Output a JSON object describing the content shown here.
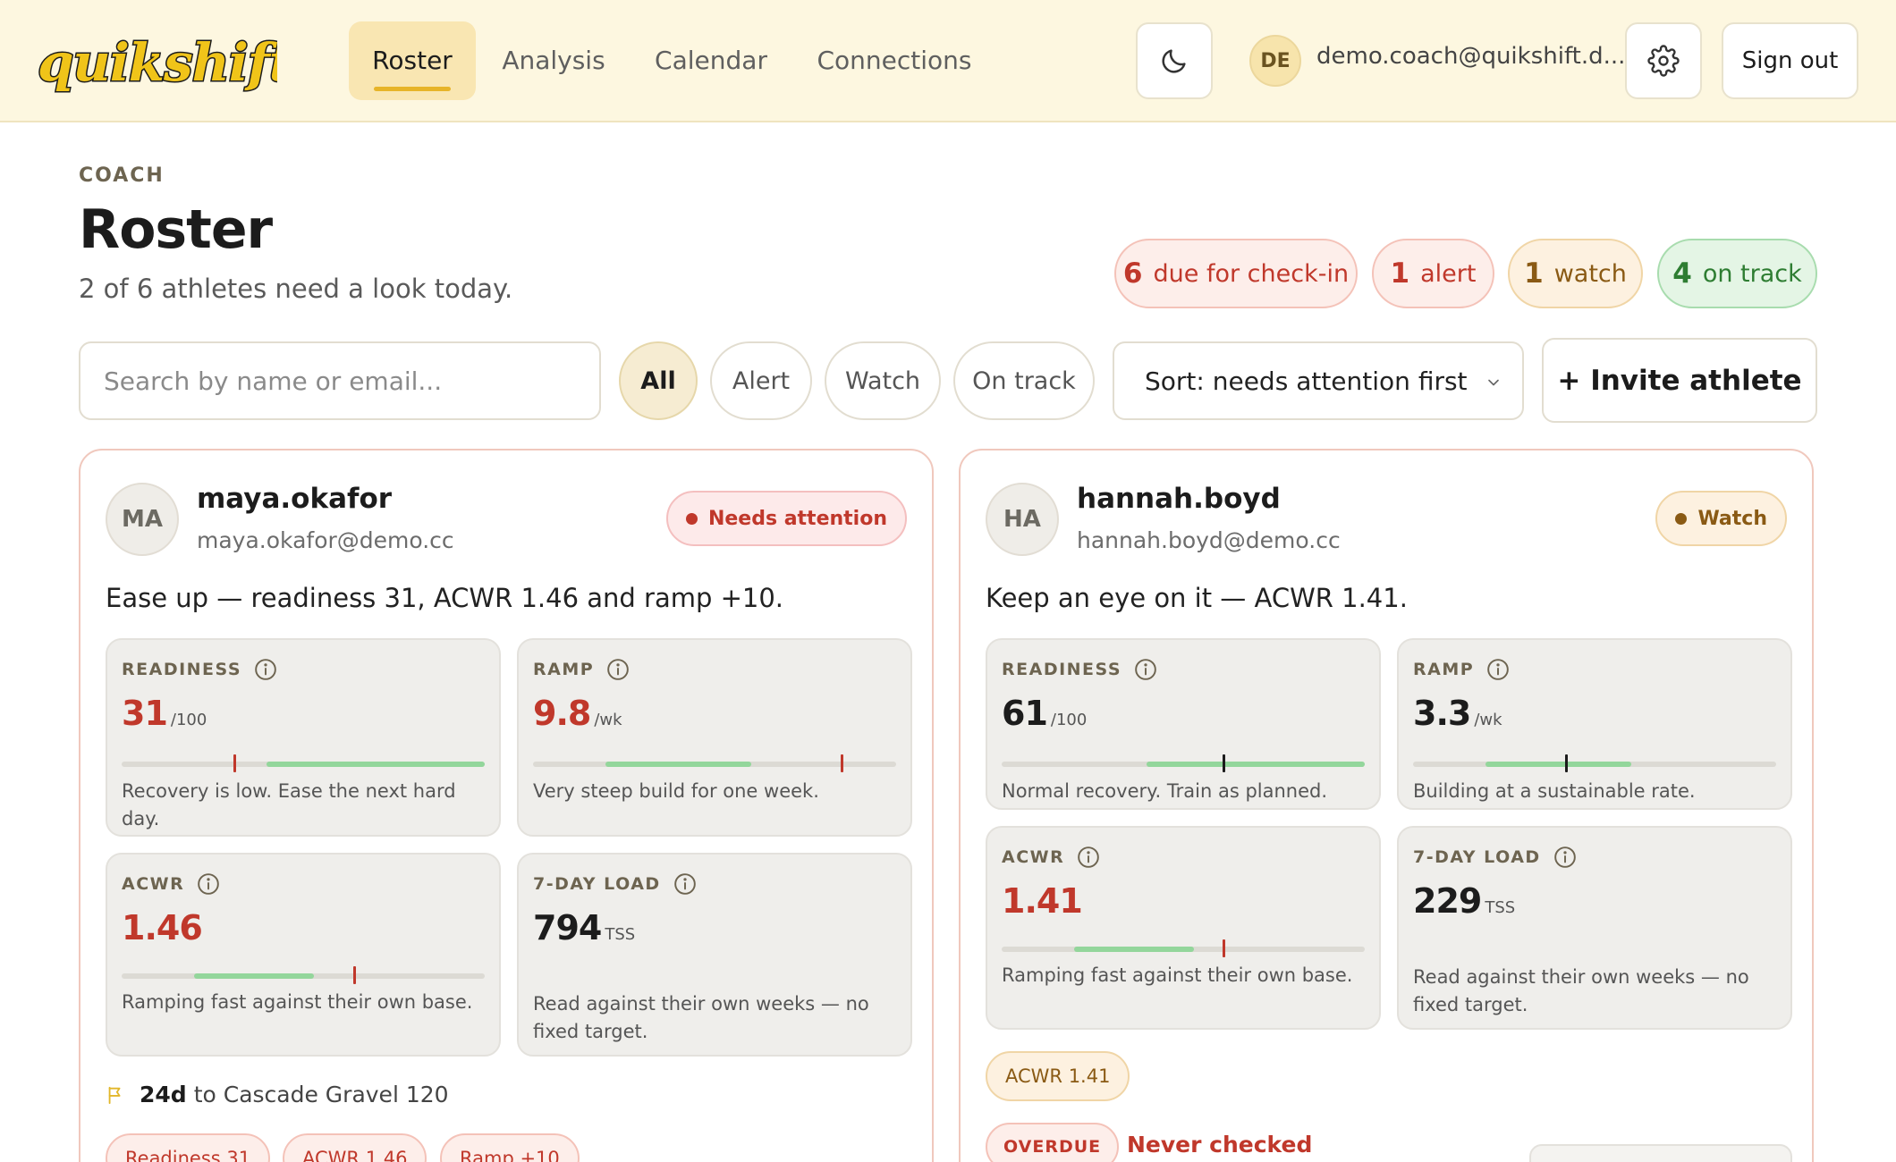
{
  "header": {
    "logo_text": "quikshift",
    "nav": [
      {
        "label": "Roster",
        "active": true
      },
      {
        "label": "Analysis",
        "active": false
      },
      {
        "label": "Calendar",
        "active": false
      },
      {
        "label": "Connections",
        "active": false
      }
    ],
    "user_initials": "DE",
    "user_email": "demo.coach@quikshift.d...",
    "sign_out_label": "Sign out",
    "theme_icon": "moon-icon",
    "settings_icon": "gear-icon"
  },
  "page": {
    "eyebrow": "COACH",
    "title": "Roster",
    "subtitle": "2 of 6 athletes need a look today."
  },
  "counts": {
    "due": {
      "num": "6",
      "label": "due for check-in"
    },
    "alert": {
      "num": "1",
      "label": "alert"
    },
    "watch": {
      "num": "1",
      "label": "watch"
    },
    "on_track": {
      "num": "4",
      "label": "on track"
    }
  },
  "filters": {
    "search_placeholder": "Search by name or email...",
    "chips": [
      "All",
      "Alert",
      "Watch",
      "On track"
    ],
    "active_chip": "All",
    "sort_value": "Sort: needs attention first",
    "invite_label": "+ Invite athlete"
  },
  "colors": {
    "brand_yellow": "#f0c419",
    "alert_red": "#c0382b",
    "watch_amber": "#8a5a14",
    "ok_green": "#2e7d32",
    "band_green": "#93d69b"
  },
  "athletes": [
    {
      "initials": "MA",
      "name": "maya.okafor",
      "email": "maya.okafor@demo.cc",
      "status": "Needs attention",
      "summary": "Ease up — readiness 31, ACWR 1.46 and ramp +10.",
      "readiness": {
        "label": "READINESS",
        "value": "31",
        "unit": "/100",
        "desc": "Recovery is low. Ease the next hard day.",
        "marker": 0.31,
        "band": [
          0.4,
          1.0
        ]
      },
      "ramp": {
        "label": "RAMP",
        "value": "9.8",
        "unit": "/wk",
        "desc": "Very steep build for one week.",
        "marker": 0.85,
        "band": [
          0.2,
          0.6
        ]
      },
      "acwr": {
        "label": "ACWR",
        "value": "1.46",
        "unit": "",
        "desc": "Ramping fast against their own base.",
        "marker": 0.64,
        "band": [
          0.2,
          0.53
        ]
      },
      "load7": {
        "label": "7-DAY LOAD",
        "value": "794",
        "unit": "TSS",
        "desc": "Read against their own weeks — no fixed target."
      },
      "race_days": "24d",
      "race_text": "to Cascade Gravel 120",
      "flags": [
        "Readiness 31",
        "ACWR 1.46",
        "Ramp +10"
      ]
    },
    {
      "initials": "HA",
      "name": "hannah.boyd",
      "email": "hannah.boyd@demo.cc",
      "status": "Watch",
      "summary": "Keep an eye on it — ACWR 1.41.",
      "readiness": {
        "label": "READINESS",
        "value": "61",
        "unit": "/100",
        "desc": "Normal recovery. Train as planned.",
        "marker": 0.61,
        "band": [
          0.4,
          1.0
        ]
      },
      "ramp": {
        "label": "RAMP",
        "value": "3.3",
        "unit": "/wk",
        "desc": "Building at a sustainable rate.",
        "marker": 0.42,
        "band": [
          0.2,
          0.6
        ]
      },
      "acwr": {
        "label": "ACWR",
        "value": "1.41",
        "unit": "",
        "desc": "Ramping fast against their own base.",
        "marker": 0.61,
        "band": [
          0.2,
          0.53
        ]
      },
      "load7": {
        "label": "7-DAY LOAD",
        "value": "229",
        "unit": "TSS",
        "desc": "Read against their own weeks — no fixed target."
      },
      "flags": [
        "ACWR 1.41"
      ],
      "overdue_label": "OVERDUE",
      "checkin_status": "Never checked"
    }
  ]
}
